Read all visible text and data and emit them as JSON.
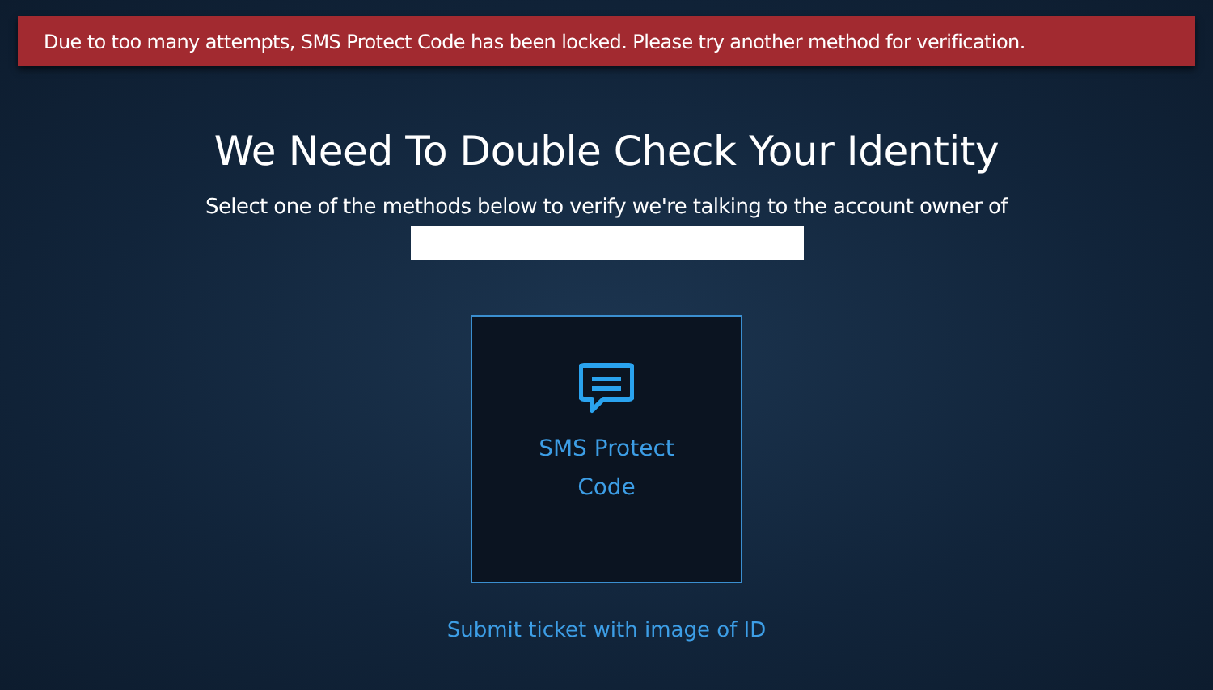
{
  "alert": {
    "text": "Due to too many attempts, SMS Protect Code has been locked. Please try another method for verification."
  },
  "title": "We Need To Double Check Your Identity",
  "subtitle": "Select one of the methods below to verify we're talking to the account owner of",
  "methods": [
    {
      "label": "SMS Protect Code",
      "kind": "sms"
    }
  ],
  "ticket_link": "Submit ticket with image of ID"
}
